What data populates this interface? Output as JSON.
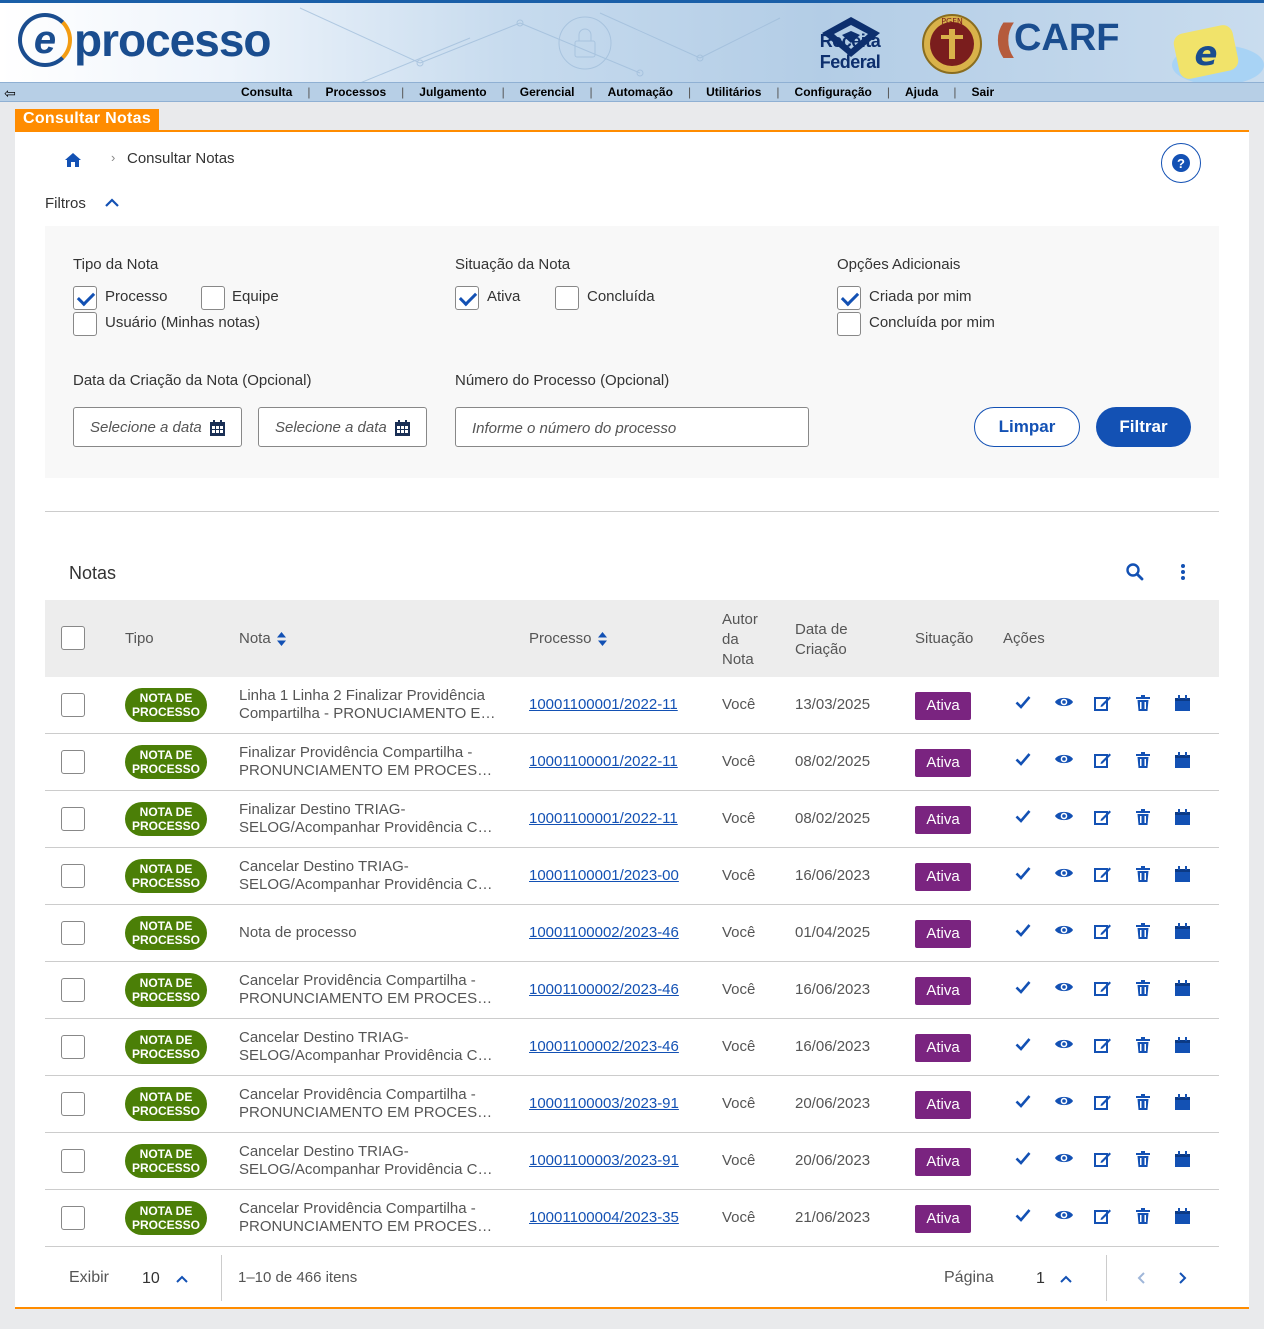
{
  "header": {
    "logo_text": "processo",
    "logo_e": "e",
    "rf_text": "Receita Federal",
    "pgfn_text": "PGFN",
    "carf_text": "CARF",
    "menu": [
      "Consulta",
      "Processos",
      "Julgamento",
      "Gerencial",
      "Automação",
      "Utilitários",
      "Configuração",
      "Ajuda",
      "Sair"
    ]
  },
  "page": {
    "tab_title": "Consultar Notas",
    "breadcrumb": "Consultar Notas",
    "filtros_label": "Filtros"
  },
  "filters": {
    "tipo_label": "Tipo da Nota",
    "tipo_processo": "Processo",
    "tipo_equipe": "Equipe",
    "tipo_usuario": "Usuário (Minhas notas)",
    "situacao_label": "Situação da Nota",
    "situacao_ativa": "Ativa",
    "situacao_concluida": "Concluída",
    "opcoes_label": "Opções Adicionais",
    "opcao_criada": "Criada por mim",
    "opcao_concluida": "Concluída por mim",
    "data_label": "Data da Criação da Nota (Opcional)",
    "data_placeholder_1": "Selecione a data i",
    "data_placeholder_2": "Selecione a data i",
    "numero_label": "Número do Processo (Opcional)",
    "numero_placeholder": "Informe o número do processo",
    "limpar": "Limpar",
    "filtrar": "Filtrar",
    "checked": {
      "processo": true,
      "equipe": false,
      "usuario": false,
      "ativa": true,
      "concluida": false,
      "criada": true,
      "concluida_por_mim": false
    }
  },
  "table": {
    "title": "Notas",
    "headers": {
      "tipo": "Tipo",
      "nota": "Nota",
      "processo": "Processo",
      "autor_1": "Autor",
      "autor_2": "da",
      "autor_3": "Nota",
      "data_1": "Data de",
      "data_2": "Criação",
      "situacao": "Situação",
      "acoes": "Ações"
    },
    "rows": [
      {
        "tipo_1": "NOTA DE",
        "tipo_2": "PROCESSO",
        "nota_1": "Linha 1 Linha 2 Finalizar Providência",
        "nota_2": "Compartilha - PRONUCIAMENTO EM PROCESSO",
        "processo": "10001100001/2022-11",
        "autor": "Você",
        "data": "13/03/2025",
        "situacao": "Ativa"
      },
      {
        "tipo_1": "NOTA DE",
        "tipo_2": "PROCESSO",
        "nota_1": "Finalizar Providência Compartilha -",
        "nota_2": "PRONUNCIAMENTO EM PROCESSO SOBRESTADO",
        "processo": "10001100001/2022-11",
        "autor": "Você",
        "data": "08/02/2025",
        "situacao": "Ativa"
      },
      {
        "tipo_1": "NOTA DE",
        "tipo_2": "PROCESSO",
        "nota_1": "Finalizar Destino TRIAG-",
        "nota_2": "SELOG/Acompanhar Providência Compartilhada",
        "processo": "10001100001/2022-11",
        "autor": "Você",
        "data": "08/02/2025",
        "situacao": "Ativa"
      },
      {
        "tipo_1": "NOTA DE",
        "tipo_2": "PROCESSO",
        "nota_1": "Cancelar Destino TRIAG-",
        "nota_2": "SELOG/Acompanhar Providência Compartilhada",
        "processo": "10001100001/2023-00",
        "autor": "Você",
        "data": "16/06/2023",
        "situacao": "Ativa"
      },
      {
        "tipo_1": "NOTA DE",
        "tipo_2": "PROCESSO",
        "nota_1": "Nota de processo",
        "nota_2": "",
        "processo": "10001100002/2023-46",
        "autor": "Você",
        "data": "01/04/2025",
        "situacao": "Ativa"
      },
      {
        "tipo_1": "NOTA DE",
        "tipo_2": "PROCESSO",
        "nota_1": "Cancelar Providência Compartilha -",
        "nota_2": "PRONUNCIAMENTO EM PROCESSO SOBRESTADO",
        "processo": "10001100002/2023-46",
        "autor": "Você",
        "data": "16/06/2023",
        "situacao": "Ativa"
      },
      {
        "tipo_1": "NOTA DE",
        "tipo_2": "PROCESSO",
        "nota_1": "Cancelar Destino TRIAG-",
        "nota_2": "SELOG/Acompanhar Providência Compartilhada",
        "processo": "10001100002/2023-46",
        "autor": "Você",
        "data": "16/06/2023",
        "situacao": "Ativa"
      },
      {
        "tipo_1": "NOTA DE",
        "tipo_2": "PROCESSO",
        "nota_1": "Cancelar Providência Compartilha -",
        "nota_2": "PRONUNCIAMENTO EM PROCESSO SOBRESTADO",
        "processo": "10001100003/2023-91",
        "autor": "Você",
        "data": "20/06/2023",
        "situacao": "Ativa"
      },
      {
        "tipo_1": "NOTA DE",
        "tipo_2": "PROCESSO",
        "nota_1": "Cancelar Destino TRIAG-",
        "nota_2": "SELOG/Acompanhar Providência Compartilhada",
        "processo": "10001100003/2023-91",
        "autor": "Você",
        "data": "20/06/2023",
        "situacao": "Ativa"
      },
      {
        "tipo_1": "NOTA DE",
        "tipo_2": "PROCESSO",
        "nota_1": "Cancelar Providência Compartilha -",
        "nota_2": "PRONUNCIAMENTO EM PROCESSO SOBRESTADO",
        "processo": "10001100004/2023-35",
        "autor": "Você",
        "data": "21/06/2023",
        "situacao": "Ativa"
      }
    ],
    "action_icons": [
      "check-icon",
      "eye-icon",
      "edit-icon",
      "trash-icon",
      "calendar-icon"
    ]
  },
  "footer": {
    "exibir": "Exibir",
    "per_page": "10",
    "range": "1–10 de 466 itens",
    "pagina": "Página",
    "page_num": "1"
  },
  "colors": {
    "primary": "#1351b4",
    "accent": "#ff8c00",
    "tipo_badge": "#4b7f07",
    "status_badge": "#7a2480"
  }
}
